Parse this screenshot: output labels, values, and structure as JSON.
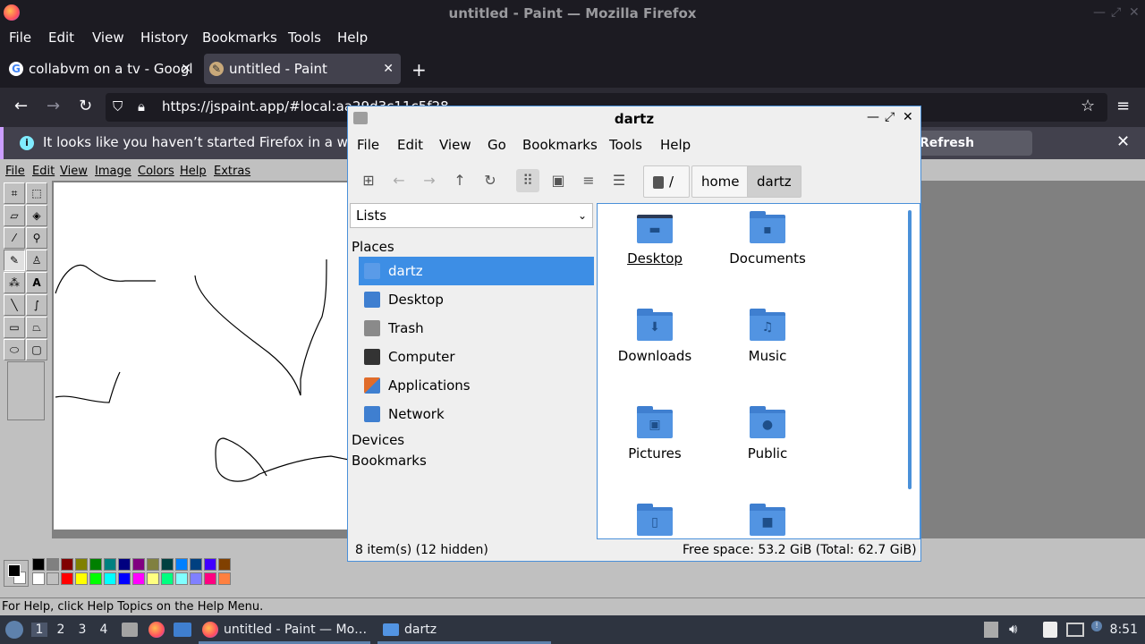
{
  "window_title": "untitled - Paint — Mozilla Firefox",
  "firefox_menu": [
    "File",
    "Edit",
    "View",
    "History",
    "Bookmarks",
    "Tools",
    "Help"
  ],
  "tabs": [
    {
      "label": "collabvm on a tv - Googl",
      "icon": "google-icon"
    },
    {
      "label": "untitled - Paint",
      "icon": "paint-icon"
    }
  ],
  "url": "https://jspaint.app/#local:aa29d3c11c5f28",
  "infobar": {
    "text": "It looks like you haven’t started Firefox in a while. D",
    "button": "Refresh Firefox…"
  },
  "paint": {
    "menu": [
      "File",
      "Edit",
      "View",
      "Image",
      "Colors",
      "Help",
      "Extras"
    ],
    "status": "For Help, click Help Topics on the Help Menu.",
    "palette_top": [
      "#000000",
      "#808080",
      "#800000",
      "#808000",
      "#008000",
      "#008080",
      "#000080",
      "#800080",
      "#808040",
      "#004040",
      "#0080ff",
      "#004080",
      "#4000ff",
      "#804000"
    ],
    "palette_bottom": [
      "#ffffff",
      "#c0c0c0",
      "#ff0000",
      "#ffff00",
      "#00ff00",
      "#00ffff",
      "#0000ff",
      "#ff00ff",
      "#ffff80",
      "#00ff80",
      "#80ffff",
      "#8080ff",
      "#ff0080",
      "#ff8040"
    ]
  },
  "file_manager": {
    "title": "dartz",
    "menu": [
      "File",
      "Edit",
      "View",
      "Go",
      "Bookmarks",
      "Tools",
      "Help"
    ],
    "breadcrumbs": [
      "/",
      "home",
      "dartz"
    ],
    "side_select": "Lists",
    "places_heading": "Places",
    "places": [
      {
        "label": "dartz",
        "icon": "home-icon",
        "color": "#3d8ee5"
      },
      {
        "label": "Desktop",
        "icon": "desktop-icon",
        "color": "#3f7fd0"
      },
      {
        "label": "Trash",
        "icon": "trash-icon",
        "color": "#8a8a8a"
      },
      {
        "label": "Computer",
        "icon": "computer-icon",
        "color": "#333333"
      },
      {
        "label": "Applications",
        "icon": "applications-icon",
        "color": "#e06c2a"
      },
      {
        "label": "Network",
        "icon": "network-icon",
        "color": "#3f7fd0"
      }
    ],
    "devices_heading": "Devices",
    "bookmarks_heading": "Bookmarks",
    "items": [
      {
        "label": "Desktop",
        "glyph": "▬"
      },
      {
        "label": "Documents",
        "glyph": "▪"
      },
      {
        "label": "Downloads",
        "glyph": "⬇"
      },
      {
        "label": "Music",
        "glyph": "♫"
      },
      {
        "label": "Pictures",
        "glyph": "▣"
      },
      {
        "label": "Public",
        "glyph": "●"
      },
      {
        "label": "",
        "glyph": "▯"
      },
      {
        "label": "",
        "glyph": "■"
      }
    ],
    "status_left": "8 item(s) (12 hidden)",
    "status_right": "Free space: 53.2 GiB (Total: 62.7 GiB)"
  },
  "taskbar": {
    "workspaces": [
      "1",
      "2",
      "3",
      "4"
    ],
    "tasks": [
      "untitled - Paint — Mo…",
      "dartz"
    ],
    "clock": "8:51"
  }
}
